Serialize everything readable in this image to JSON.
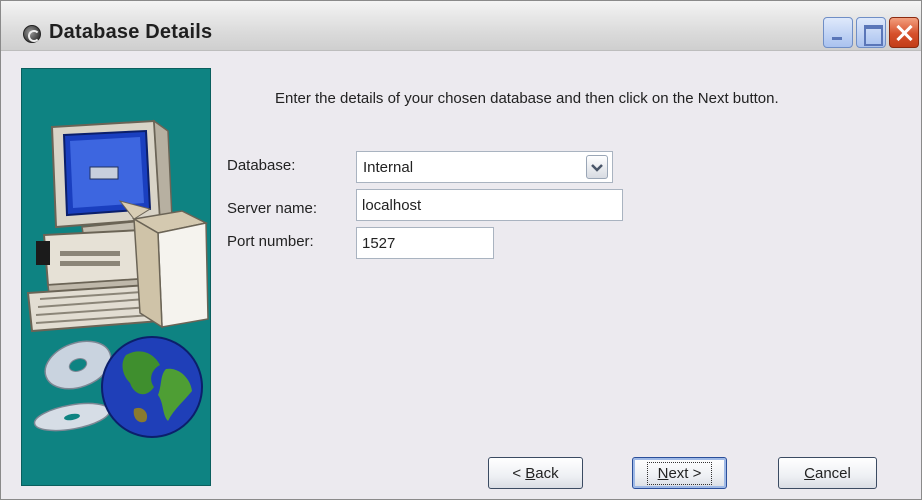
{
  "window": {
    "title": "Database Details",
    "title_icon": "gear-icon",
    "controls": {
      "minimize": "minimize-icon",
      "maximize": "maximize-icon",
      "close": "close-icon"
    }
  },
  "side_panel": {
    "illustration": "computer-disc-globe-illustration",
    "background": "#0e8382"
  },
  "main": {
    "instruction": "Enter the details of your chosen database and then click on the Next button.",
    "fields": {
      "database": {
        "label": "Database:",
        "value": "Internal"
      },
      "server": {
        "label": "Server name:",
        "value": "localhost"
      },
      "port": {
        "label": "Port number:",
        "value": "1527"
      }
    }
  },
  "buttons": {
    "back": {
      "prefix": "< ",
      "mnemonic": "B",
      "rest": "ack"
    },
    "next": {
      "mnemonic": "N",
      "rest": "ext >"
    },
    "cancel": {
      "mnemonic": "C",
      "rest": "ancel"
    }
  }
}
